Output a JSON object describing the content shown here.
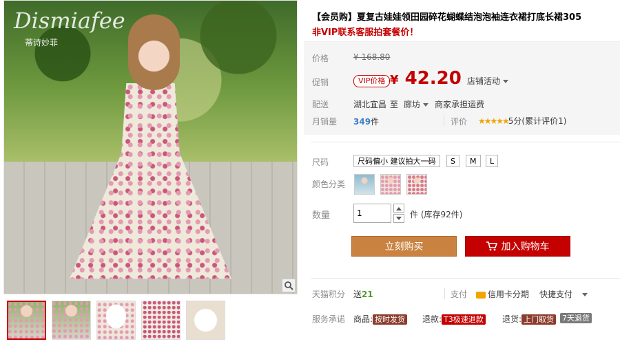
{
  "gallery": {
    "watermark": "Dismiafee",
    "watermark_sub": "蒂诗妙菲",
    "thumbnails": [
      "thumb-1",
      "thumb-2",
      "thumb-3",
      "thumb-4",
      "thumb-5"
    ],
    "zoom_icon": "magnifier-icon"
  },
  "product": {
    "title": "【会员购】夏复古娃娃领田园碎花蝴蝶结泡泡袖连衣裙打底长裙305",
    "subtitle": "非VIP联系客服拍套餐价！"
  },
  "price": {
    "label": "价格",
    "original": "¥ 168.80",
    "promo_label": "促销",
    "vip_badge": "VIP价格",
    "currency": "¥",
    "amount": "42.20",
    "store_activity": "店铺活动"
  },
  "shipping": {
    "label": "配送",
    "from": "湖北宜昌",
    "to_word": "至",
    "dest": "廊坊",
    "fee": "商家承担运费"
  },
  "sales": {
    "label": "月销量",
    "count": "349",
    "unit": "件",
    "rating_label": "评价",
    "stars": "★★★★★",
    "rating_text": "5分(累计评价1)"
  },
  "sku": {
    "size_label": "尺码",
    "sizes": [
      "尺码偏小 建议拍大一码",
      "S",
      "M",
      "L"
    ],
    "color_label": "颜色分类",
    "qty_label": "数量",
    "qty_value": "1",
    "stock_text": "件 (库存92件)"
  },
  "actions": {
    "buy_now": "立刻购买",
    "add_cart": "加入购物车"
  },
  "footer": {
    "points_label": "天猫积分",
    "points_prefix": "送",
    "points_value": "21",
    "pay_label": "支付",
    "credit_installment": "信用卡分期",
    "quick_pay": "快捷支付",
    "service_label": "服务承诺",
    "service_items": [
      {
        "prefix": "商品:",
        "tag": "按时发货"
      },
      {
        "prefix": "退款:",
        "tag": "T3极速退款"
      },
      {
        "prefix": "退货:",
        "tag": "上门取货"
      },
      {
        "prefix": "",
        "tag": "7天退货"
      }
    ]
  },
  "colors": {
    "accent_red": "#c40000",
    "buy_orange": "#c98240",
    "star_gold": "#f2a400"
  }
}
